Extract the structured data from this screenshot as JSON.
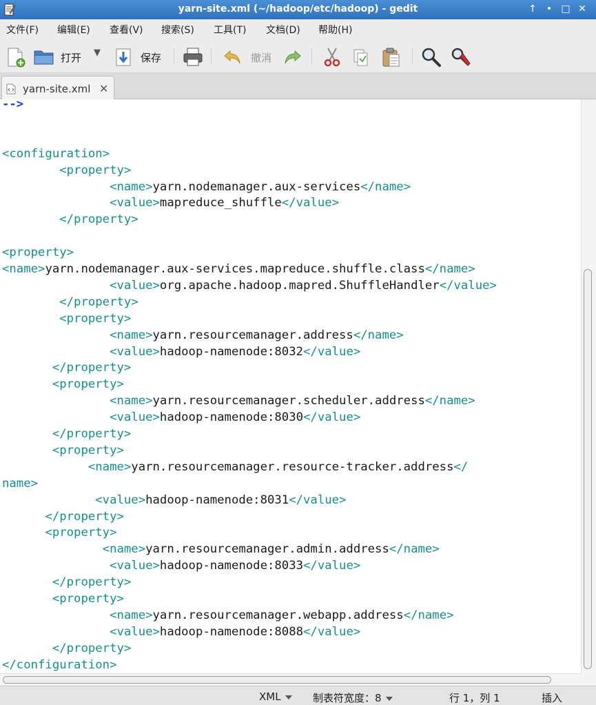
{
  "window": {
    "title": "yarn-site.xml (~/hadoop/etc/hadoop) - gedit",
    "buttons": [
      "↑",
      "•",
      "□",
      "✕"
    ]
  },
  "menu": [
    "文件(F)",
    "编辑(E)",
    "查看(V)",
    "搜索(S)",
    "工具(T)",
    "文档(D)",
    "帮助(H)"
  ],
  "toolbar": {
    "open_label": "打开",
    "save_label": "保存",
    "undo_label": "撤消",
    "icons": [
      "new-document-icon",
      "open-folder-icon",
      "dropdown-arrow-icon",
      "save-download-icon",
      "print-icon",
      "undo-icon",
      "redo-icon",
      "cut-icon",
      "copy-icon",
      "paste-icon",
      "search-icon",
      "replace-icon"
    ]
  },
  "tab": {
    "label": "yarn-site.xml",
    "close": "✕"
  },
  "editor": {
    "lines": [
      {
        "indent": "",
        "parts": [
          {
            "k": "c",
            "s": "-->"
          }
        ]
      },
      {
        "indent": "",
        "parts": []
      },
      {
        "indent": "",
        "parts": []
      },
      {
        "indent": "",
        "parts": [
          {
            "k": "t",
            "s": "<configuration>"
          }
        ]
      },
      {
        "indent": "        ",
        "parts": [
          {
            "k": "t",
            "s": "<property>"
          }
        ]
      },
      {
        "indent": "               ",
        "parts": [
          {
            "k": "t",
            "s": "<name>"
          },
          {
            "k": "x",
            "s": "yarn.nodemanager.aux-services"
          },
          {
            "k": "t",
            "s": "</name>"
          }
        ]
      },
      {
        "indent": "               ",
        "parts": [
          {
            "k": "t",
            "s": "<value>"
          },
          {
            "k": "x",
            "s": "mapreduce_shuffle"
          },
          {
            "k": "t",
            "s": "</value>"
          }
        ]
      },
      {
        "indent": "        ",
        "parts": [
          {
            "k": "t",
            "s": "</property>"
          }
        ]
      },
      {
        "indent": "",
        "parts": []
      },
      {
        "indent": "",
        "parts": [
          {
            "k": "t",
            "s": "<property>"
          }
        ]
      },
      {
        "indent": "",
        "parts": [
          {
            "k": "t",
            "s": "<name>"
          },
          {
            "k": "x",
            "s": "yarn.nodemanager.aux-services.mapreduce.shuffle.class"
          },
          {
            "k": "t",
            "s": "</name>"
          }
        ]
      },
      {
        "indent": "               ",
        "parts": [
          {
            "k": "t",
            "s": "<value>"
          },
          {
            "k": "x",
            "s": "org.apache.hadoop.mapred.ShuffleHandler"
          },
          {
            "k": "t",
            "s": "</value>"
          }
        ]
      },
      {
        "indent": "        ",
        "parts": [
          {
            "k": "t",
            "s": "</property>"
          }
        ]
      },
      {
        "indent": "        ",
        "parts": [
          {
            "k": "t",
            "s": "<property>"
          }
        ]
      },
      {
        "indent": "               ",
        "parts": [
          {
            "k": "t",
            "s": "<name>"
          },
          {
            "k": "x",
            "s": "yarn.resourcemanager.address"
          },
          {
            "k": "t",
            "s": "</name>"
          }
        ]
      },
      {
        "indent": "               ",
        "parts": [
          {
            "k": "t",
            "s": "<value>"
          },
          {
            "k": "x",
            "s": "hadoop-namenode:8032"
          },
          {
            "k": "t",
            "s": "</value>"
          }
        ]
      },
      {
        "indent": "       ",
        "parts": [
          {
            "k": "t",
            "s": "</property>"
          }
        ]
      },
      {
        "indent": "       ",
        "parts": [
          {
            "k": "t",
            "s": "<property>"
          }
        ]
      },
      {
        "indent": "               ",
        "parts": [
          {
            "k": "t",
            "s": "<name>"
          },
          {
            "k": "x",
            "s": "yarn.resourcemanager.scheduler.address"
          },
          {
            "k": "t",
            "s": "</name>"
          }
        ]
      },
      {
        "indent": "               ",
        "parts": [
          {
            "k": "t",
            "s": "<value>"
          },
          {
            "k": "x",
            "s": "hadoop-namenode:8030"
          },
          {
            "k": "t",
            "s": "</value>"
          }
        ]
      },
      {
        "indent": "       ",
        "parts": [
          {
            "k": "t",
            "s": "</property>"
          }
        ]
      },
      {
        "indent": "       ",
        "parts": [
          {
            "k": "t",
            "s": "<property>"
          }
        ]
      },
      {
        "indent": "            ",
        "parts": [
          {
            "k": "t",
            "s": "<name>"
          },
          {
            "k": "x",
            "s": "yarn.resourcemanager.resource-tracker.address"
          },
          {
            "k": "t",
            "s": "</"
          }
        ]
      },
      {
        "indent": "",
        "parts": [
          {
            "k": "t",
            "s": "name>"
          }
        ]
      },
      {
        "indent": "             ",
        "parts": [
          {
            "k": "t",
            "s": "<value>"
          },
          {
            "k": "x",
            "s": "hadoop-namenode:8031"
          },
          {
            "k": "t",
            "s": "</value>"
          }
        ]
      },
      {
        "indent": "      ",
        "parts": [
          {
            "k": "t",
            "s": "</property>"
          }
        ]
      },
      {
        "indent": "      ",
        "parts": [
          {
            "k": "t",
            "s": "<property>"
          }
        ]
      },
      {
        "indent": "              ",
        "parts": [
          {
            "k": "t",
            "s": "<name>"
          },
          {
            "k": "x",
            "s": "yarn.resourcemanager.admin.address"
          },
          {
            "k": "t",
            "s": "</name>"
          }
        ]
      },
      {
        "indent": "               ",
        "parts": [
          {
            "k": "t",
            "s": "<value>"
          },
          {
            "k": "x",
            "s": "hadoop-namenode:8033"
          },
          {
            "k": "t",
            "s": "</value>"
          }
        ]
      },
      {
        "indent": "       ",
        "parts": [
          {
            "k": "t",
            "s": "</property>"
          }
        ]
      },
      {
        "indent": "       ",
        "parts": [
          {
            "k": "t",
            "s": "<property>"
          }
        ]
      },
      {
        "indent": "               ",
        "parts": [
          {
            "k": "t",
            "s": "<name>"
          },
          {
            "k": "x",
            "s": "yarn.resourcemanager.webapp.address"
          },
          {
            "k": "t",
            "s": "</name>"
          }
        ]
      },
      {
        "indent": "               ",
        "parts": [
          {
            "k": "t",
            "s": "<value>"
          },
          {
            "k": "x",
            "s": "hadoop-namenode:8088"
          },
          {
            "k": "t",
            "s": "</value>"
          }
        ]
      },
      {
        "indent": "       ",
        "parts": [
          {
            "k": "t",
            "s": "</property>"
          }
        ]
      },
      {
        "indent": "",
        "parts": [
          {
            "k": "t",
            "s": "</configuration>"
          }
        ]
      }
    ],
    "colors": {
      "tag": "#138f8f",
      "comment": "#1f3bd6",
      "text": "#1a1a1a"
    }
  },
  "statusbar": {
    "language": "XML",
    "tab_width": "制表符宽度：8",
    "position": "行 1，列 1",
    "mode": "插入"
  }
}
